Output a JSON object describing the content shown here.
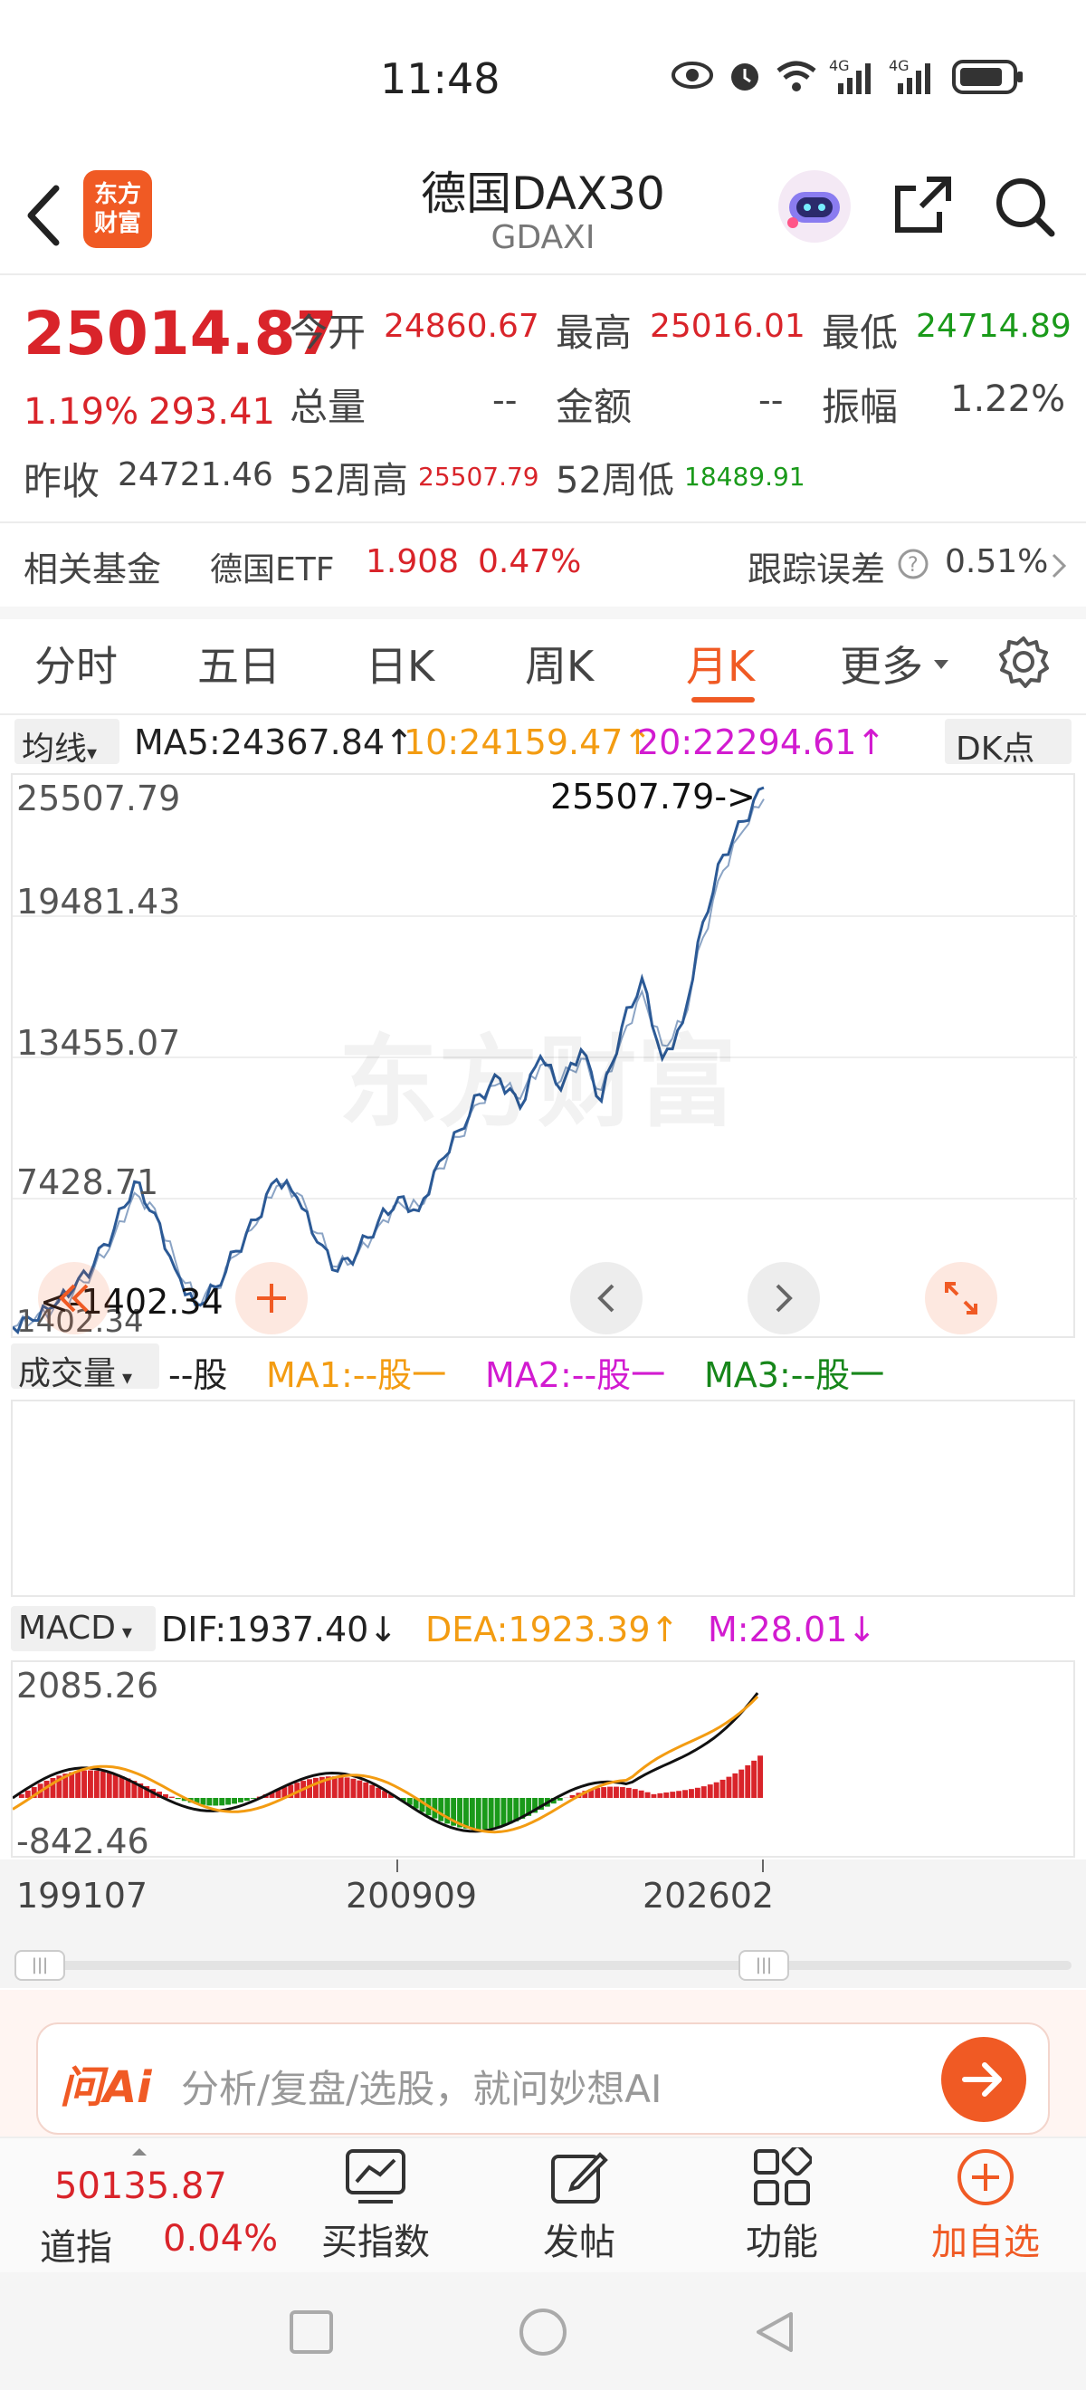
{
  "status": {
    "time": "11:48",
    "battery_icon": "battery-icon",
    "signal1": "4G",
    "signal2": "4G"
  },
  "header": {
    "title": "德国DAX30",
    "subtitle": "GDAXI",
    "logo_text_top": "东方",
    "logo_text_bottom": "财富"
  },
  "quote": {
    "price": "25014.87",
    "change_pct": "1.19%",
    "change_val": "293.41",
    "open_label": "今开",
    "open": "24860.67",
    "high_label": "最高",
    "high": "25016.01",
    "low_label": "最低",
    "low": "24714.89",
    "vol_label": "总量",
    "vol": "--",
    "amount_label": "金额",
    "amount": "--",
    "amp_label": "振幅",
    "amp": "1.22%",
    "prev_label": "昨收",
    "prev": "24721.46",
    "w52h_label": "52周高",
    "w52h": "25507.79",
    "w52l_label": "52周低",
    "w52l": "18489.91"
  },
  "fund": {
    "label": "相关基金",
    "name": "德国ETF",
    "price": "1.908",
    "pct": "0.47%",
    "track_label": "跟踪误差",
    "track": "0.51%"
  },
  "tabs": [
    "分时",
    "五日",
    "日K",
    "周K",
    "月K",
    "更多"
  ],
  "active_tab": "月K",
  "ma": {
    "selector": "均线",
    "ma5": "MA5:24367.84↑",
    "ma10": "10:24159.47↑",
    "ma20": "20:22294.61↑",
    "dk": "DK点"
  },
  "kchart": {
    "y_labels": [
      "25507.79",
      "19481.43",
      "13455.07",
      "7428.71",
      "1402.34"
    ],
    "max_marker": "25507.79->",
    "min_marker": "<-1402.34"
  },
  "volume": {
    "selector": "成交量",
    "unit": "--股",
    "ma1": "MA1:--股一",
    "ma2": "MA2:--股一",
    "ma3": "MA3:--股一"
  },
  "macd": {
    "selector": "MACD",
    "dif": "DIF:1937.40↓",
    "dea": "DEA:1923.39↑",
    "m": "M:28.01↓",
    "y_top": "2085.26",
    "y_bottom": "-842.46"
  },
  "x_axis": [
    "199107",
    "200909",
    "202602"
  ],
  "ai_bar": {
    "brand": "问Ai",
    "placeholder": "分析/复盘/选股，就问妙想AI"
  },
  "bottom_nav": {
    "index_value": "50135.87",
    "index_name": "道指",
    "index_pct": "0.04%",
    "buy_index": "买指数",
    "post": "发帖",
    "functions": "功能",
    "add_watch": "加自选"
  },
  "chart_data": {
    "type": "line",
    "title": "",
    "series": [
      {
        "name": "",
        "values": [
          1402,
          1700,
          2300,
          3100,
          4200,
          5800,
          7900,
          6500,
          4000,
          2400,
          3200,
          4800,
          6200,
          8000,
          7200,
          5200,
          3900,
          4800,
          6100,
          7200,
          6600,
          8800,
          10200,
          11800,
          12500,
          11200,
          13500,
          12000,
          13800,
          11500,
          14800,
          17000,
          13400,
          15000,
          19500,
          22500,
          24000,
          25507.79
        ]
      },
      {
        "name": "",
        "values": [
          1402,
          1650,
          2200,
          2950,
          4000,
          5500,
          7400,
          6700,
          4400,
          2600,
          3100,
          4600,
          6000,
          7700,
          7400,
          5600,
          4100,
          4700,
          5900,
          7000,
          6800,
          8500,
          9900,
          11400,
          12300,
          11600,
          13100,
          12400,
          13400,
          12000,
          14300,
          16400,
          14000,
          15000,
          18800,
          21800,
          23600,
          25000
        ]
      }
    ],
    "ylim": [
      1402.34,
      25507.79
    ],
    "y_ticks": [
      "25507.79",
      "19481.43",
      "13455.07",
      "7428.71",
      "1402.34"
    ]
  }
}
